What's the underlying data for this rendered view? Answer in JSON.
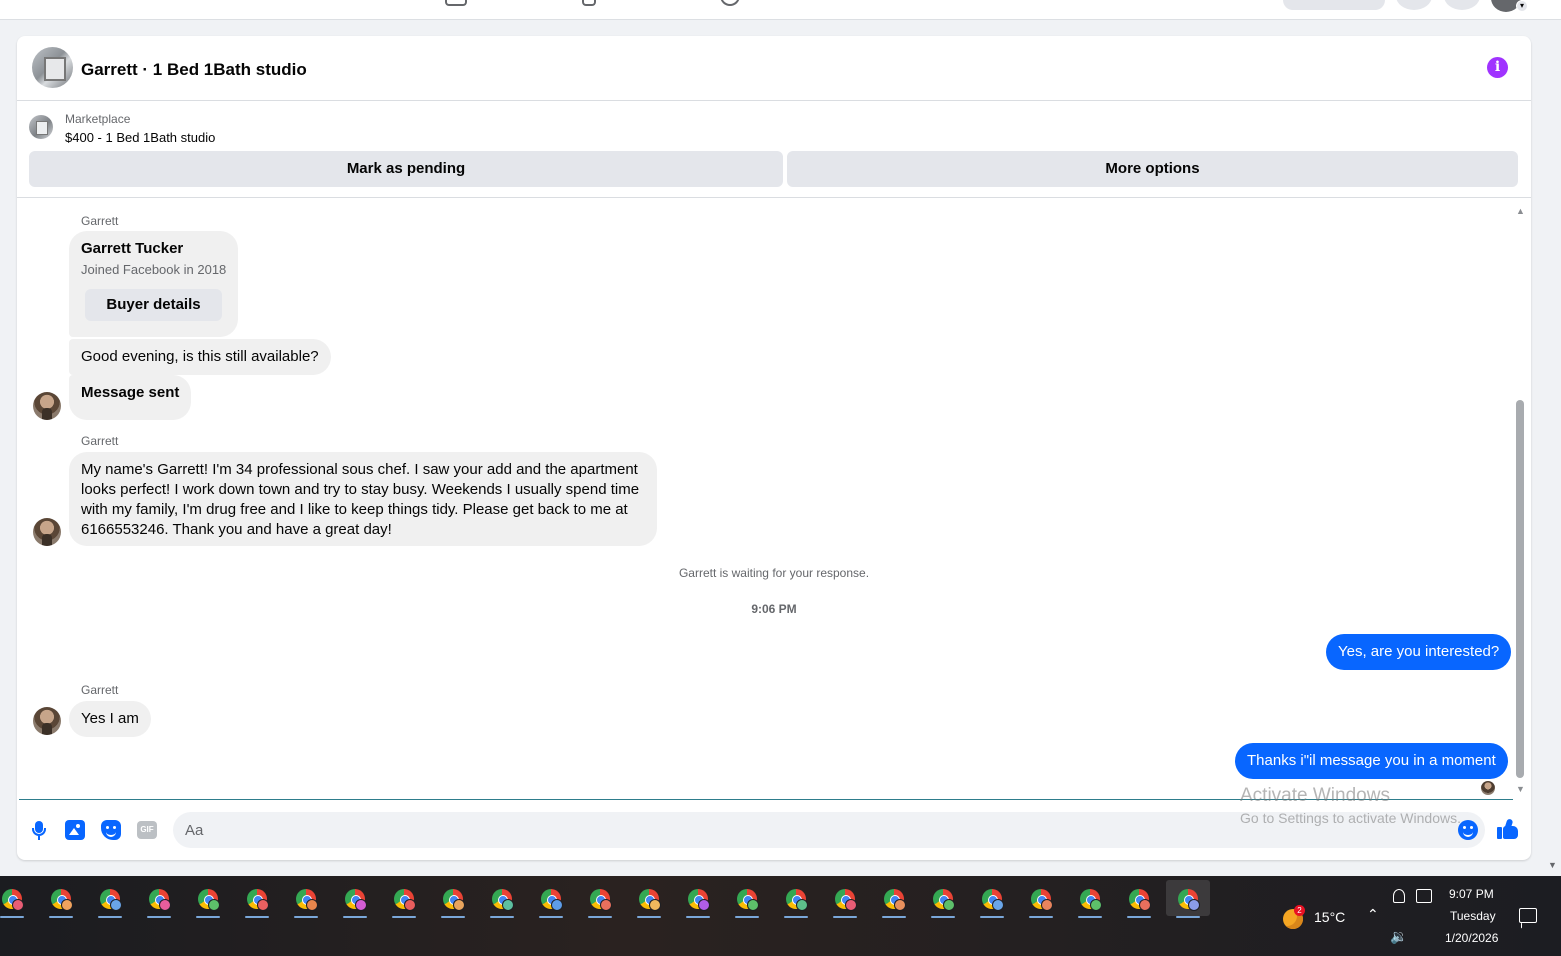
{
  "chat": {
    "title": "Garrett · 1 Bed 1Bath studio",
    "listing_label": "Marketplace",
    "listing_price": "$400 - 1 Bed 1Bath studio",
    "mark_pending_label": "Mark as pending",
    "more_options_label": "More options"
  },
  "messages": {
    "sender_name": "Garrett",
    "profile_name": "Garrett Tucker",
    "profile_joined": "Joined Facebook in 2018",
    "buyer_details_label": "Buyer details",
    "msg1": "Good evening, is this still available?",
    "msg2": "Message sent",
    "msg3": "My name's Garrett! I'm 34  professional sous chef. I saw your add and the apartment looks perfect! I work down town  and try to stay busy. Weekends I usually spend time with my family, I'm drug free and I like to keep things tidy. Please get back to me at 6166553246. Thank you and have a great day!",
    "waiting_note": "Garrett is waiting for your response.",
    "timestamp": "9:06 PM",
    "out1": "Yes, are you interested?",
    "msg4": "Yes I am",
    "out2": "Thanks i\"il message you in a moment"
  },
  "composer": {
    "placeholder": "Aa",
    "gif_label": "GIF"
  },
  "watermark": {
    "title": "Activate Windows",
    "subtitle": "Go to Settings to activate Windows."
  },
  "taskbar": {
    "app_count": 25,
    "badge_colors": [
      "#e85d75",
      "#f0a35e",
      "#6aa5e8",
      "#e85d9c",
      "#5dbf6a",
      "#e86060",
      "#e8864c",
      "#d45dd4",
      "#e85d5d",
      "#e8a45d",
      "#5dbfa0",
      "#5d9ce8",
      "#e8705d",
      "#f0b85d",
      "#b05de8",
      "#5dbf6a",
      "#5dbf8a",
      "#e85d75",
      "#e8905d",
      "#5dbf6a",
      "#6aa5e8",
      "#e8845d",
      "#5dbf6a",
      "#e86f5d",
      "#8a9ce8"
    ],
    "weather_badge": "2",
    "temperature": "15°C",
    "time": "9:07 PM",
    "day": "Tuesday",
    "date": "1/20/2026"
  },
  "colors": {
    "messenger_blue": "#0866ff",
    "incoming_bubble": "#f0f0f0",
    "info_purple": "#a033ff"
  }
}
